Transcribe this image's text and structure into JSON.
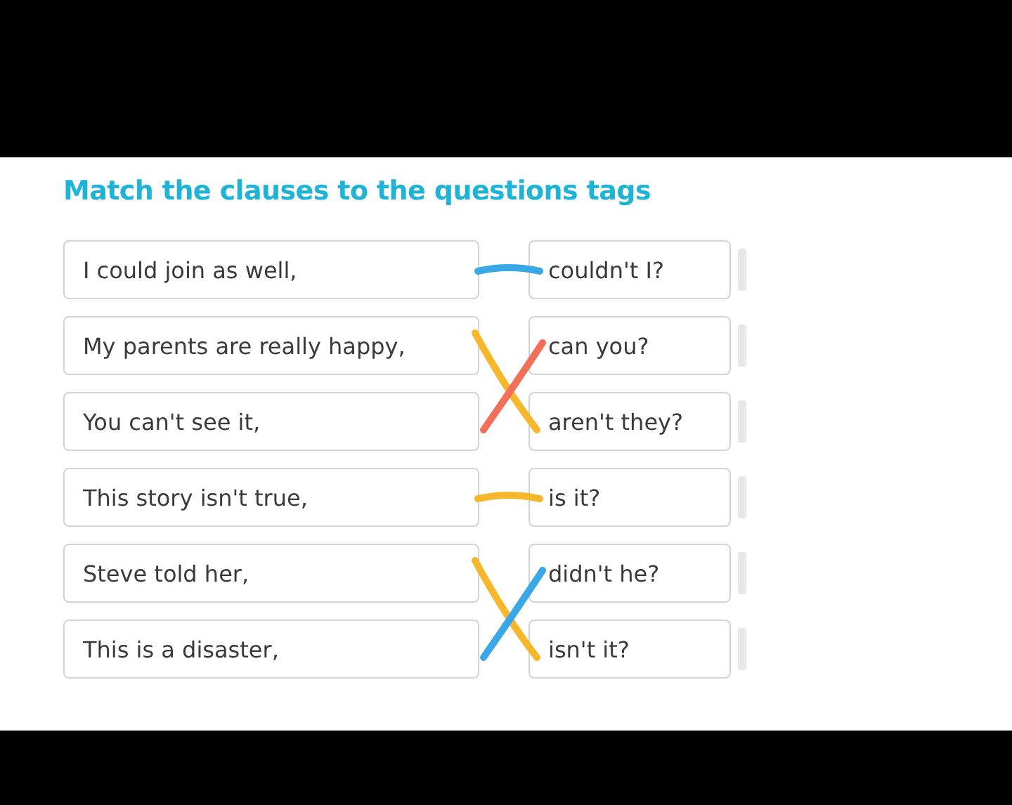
{
  "title": "Match the clauses to the questions tags",
  "clauses": [
    {
      "text": "I could join as well,",
      "stroke": {
        "kind": "level",
        "color": "#3aa8e6"
      }
    },
    {
      "text": "My parents are really happy,",
      "stroke": {
        "kind": "down",
        "color": "#f6b72c"
      }
    },
    {
      "text": "You can't see it,",
      "stroke": {
        "kind": "up",
        "color": "#f2705a"
      }
    },
    {
      "text": "This story isn't true,",
      "stroke": {
        "kind": "level",
        "color": "#f6b72c"
      }
    },
    {
      "text": "Steve told her,",
      "stroke": {
        "kind": "down",
        "color": "#f6b72c"
      }
    },
    {
      "text": "This is a disaster,",
      "stroke": {
        "kind": "up",
        "color": "#3aa8e6"
      }
    }
  ],
  "tags": [
    "couldn't I?",
    "can you?",
    "aren't they?",
    "is it?",
    "didn't he?",
    "isn't it?"
  ]
}
